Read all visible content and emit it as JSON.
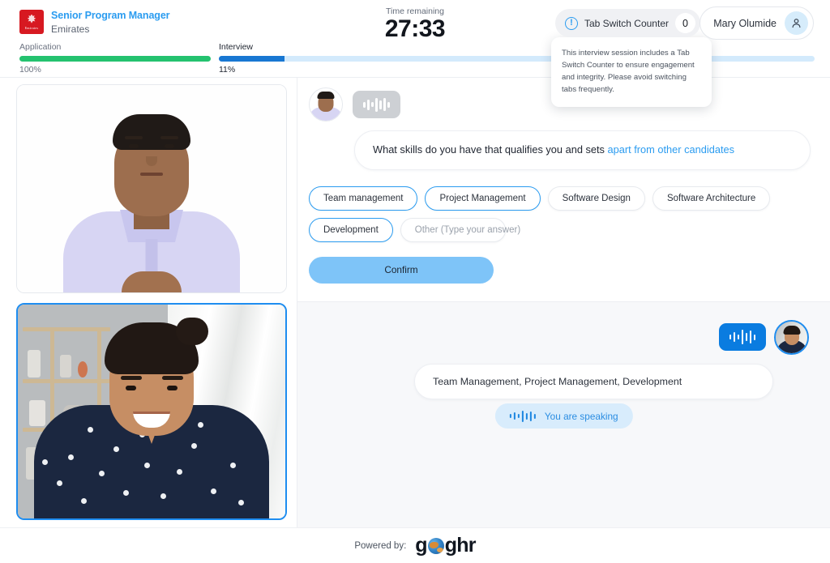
{
  "header": {
    "job_title": "Senior Program Manager",
    "company": "Emirates",
    "company_logo_text": "Emirates",
    "timer_label": "Time remaining",
    "timer_value": "27:33",
    "tab_counter": {
      "label": "Tab Switch Counter",
      "value": "0",
      "icon": "info-circle-icon",
      "tooltip": "This interview session includes a Tab Switch Counter to ensure engagement and integrity. Please avoid switching tabs frequently."
    },
    "user": {
      "name": "Mary Olumide",
      "avatar_icon": "user-person-icon"
    },
    "progress": [
      {
        "label": "Application",
        "percent_label": "100%",
        "percent": 100,
        "color": "#24c26f",
        "state": "complete"
      },
      {
        "label": "Interview",
        "percent_label": "11%",
        "percent": 11,
        "color": "#1877d2",
        "state": "active"
      }
    ]
  },
  "video": {
    "interviewer_tile_name": "interviewer-video",
    "candidate_tile_name": "candidate-video",
    "candidate_active": true
  },
  "question": {
    "speaker_icon": "voice-waveform-icon",
    "text_plain": "What skills do you have that qualifies you and sets ",
    "text_highlight": "apart from other candidates",
    "options": [
      {
        "label": "Team management",
        "selected": true
      },
      {
        "label": "Project Management",
        "selected": true
      },
      {
        "label": "Software Design",
        "selected": false
      },
      {
        "label": "Software Architecture",
        "selected": false
      },
      {
        "label": "Development",
        "selected": true
      }
    ],
    "other_placeholder": "Other (Type your answer)",
    "confirm_label": "Confirm"
  },
  "answer": {
    "speaker_icon": "voice-waveform-icon",
    "text": "Team Management, Project Management, Development"
  },
  "status": {
    "speaking_label": "You are speaking",
    "speaking_icon": "voice-waveform-icon"
  },
  "footer": {
    "powered_by_label": "Powered by:",
    "brand_part1": "g",
    "brand_part2": "ghr",
    "brand_full": "goghr"
  },
  "colors": {
    "accent_blue": "#2b9cf0",
    "progress_green": "#24c26f",
    "progress_blue": "#1877d2",
    "confirm_blue": "#7ec4f8",
    "brand_red": "#d71921"
  }
}
